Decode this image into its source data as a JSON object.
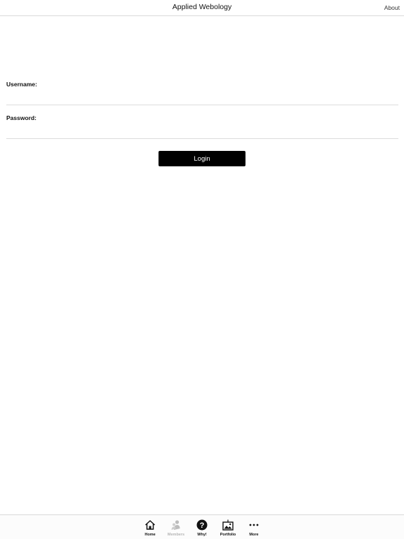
{
  "header": {
    "title": "Applied Webology",
    "about_label": "About"
  },
  "form": {
    "username_label": "Username:",
    "username_value": "",
    "password_label": "Password:",
    "password_value": "",
    "login_label": "Login"
  },
  "tabbar": {
    "items": [
      {
        "label": "Home",
        "icon": "home-icon",
        "active": true
      },
      {
        "label": "Members",
        "icon": "members-icon",
        "active": false
      },
      {
        "label": "Why!",
        "icon": "question-icon",
        "active": true
      },
      {
        "label": "Portfolio",
        "icon": "portfolio-icon",
        "active": true
      },
      {
        "label": "More",
        "icon": "more-icon",
        "active": true
      }
    ]
  },
  "colors": {
    "button_bg": "#000000",
    "inactive_tab": "#b5b5b5",
    "divider": "#d9d9d9"
  }
}
